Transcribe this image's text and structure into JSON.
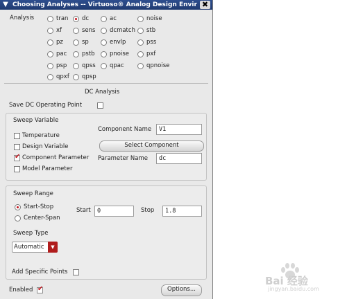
{
  "window": {
    "title": "Choosing Analyses -- Virtuoso® Analog Design Environme",
    "menu_icon": "chevron-down-icon",
    "close_icon": "close-icon"
  },
  "analysis": {
    "label": "Analysis",
    "options": [
      {
        "label": "tran",
        "selected": false
      },
      {
        "label": "dc",
        "selected": true
      },
      {
        "label": "ac",
        "selected": false
      },
      {
        "label": "noise",
        "selected": false
      },
      {
        "label": "xf",
        "selected": false
      },
      {
        "label": "sens",
        "selected": false
      },
      {
        "label": "dcmatch",
        "selected": false
      },
      {
        "label": "stb",
        "selected": false
      },
      {
        "label": "pz",
        "selected": false
      },
      {
        "label": "sp",
        "selected": false
      },
      {
        "label": "envlp",
        "selected": false
      },
      {
        "label": "pss",
        "selected": false
      },
      {
        "label": "pac",
        "selected": false
      },
      {
        "label": "pstb",
        "selected": false
      },
      {
        "label": "pnoise",
        "selected": false
      },
      {
        "label": "pxf",
        "selected": false
      },
      {
        "label": "psp",
        "selected": false
      },
      {
        "label": "qpss",
        "selected": false
      },
      {
        "label": "qpac",
        "selected": false
      },
      {
        "label": "qpnoise",
        "selected": false
      },
      {
        "label": "qpxf",
        "selected": false
      },
      {
        "label": "qpsp",
        "selected": false
      }
    ]
  },
  "dc_section": {
    "title": "DC Analysis",
    "save_op_label": "Save DC Operating Point",
    "save_op_checked": false
  },
  "sweep_variable": {
    "title": "Sweep Variable",
    "options": [
      {
        "label": "Temperature",
        "checked": false
      },
      {
        "label": "Design Variable",
        "checked": false
      },
      {
        "label": "Component Parameter",
        "checked": true
      },
      {
        "label": "Model Parameter",
        "checked": false
      }
    ],
    "component_name_label": "Component Name",
    "component_name_value": "V1",
    "select_component_label": "Select Component",
    "parameter_name_label": "Parameter Name",
    "parameter_name_value": "dc"
  },
  "sweep_range": {
    "title": "Sweep Range",
    "options": [
      {
        "label": "Start-Stop",
        "selected": true
      },
      {
        "label": "Center-Span",
        "selected": false
      }
    ],
    "start_label": "Start",
    "start_value": "0",
    "stop_label": "Stop",
    "stop_value": "1.8",
    "sweep_type_label": "Sweep Type",
    "sweep_type_value": "Automatic",
    "add_points_label": "Add Specific Points",
    "add_points_checked": false
  },
  "footer": {
    "enabled_label": "Enabled",
    "enabled_checked": true,
    "options_button": "Options..."
  },
  "watermark": {
    "text": "Bai 经验",
    "sub": "jingyan.baidu.com"
  },
  "colors": {
    "title_bar": "#1f3a70",
    "accent_red": "#c0141c",
    "panel_bg": "#e9e9e9"
  }
}
